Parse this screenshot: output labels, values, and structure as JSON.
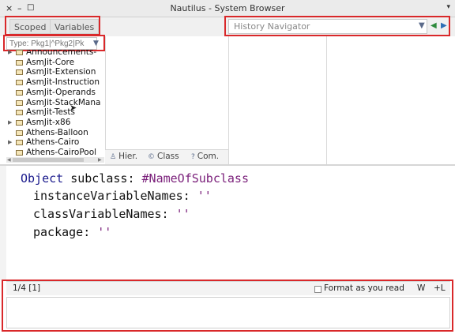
{
  "window": {
    "title": "Nautilus - System Browser",
    "controls": [
      "×",
      "–",
      "□"
    ]
  },
  "toolbar": {
    "tabs": [
      "Scoped",
      "Variables"
    ],
    "history_placeholder": "History Navigator"
  },
  "filter": {
    "placeholder": "Type: Pkg1|^Pkg2|Pk"
  },
  "packages": [
    {
      "label": "Announcements-",
      "expandable": true
    },
    {
      "label": "AsmJit-Core",
      "expandable": false
    },
    {
      "label": "AsmJit-Extension",
      "expandable": false
    },
    {
      "label": "AsmJit-Instruction",
      "expandable": false
    },
    {
      "label": "AsmJit-Operands",
      "expandable": false
    },
    {
      "label": "AsmJit-StackMana",
      "expandable": false
    },
    {
      "label": "AsmJit-Tests",
      "expandable": false
    },
    {
      "label": "AsmJit-x86",
      "expandable": true
    },
    {
      "label": "Athens-Balloon",
      "expandable": false
    },
    {
      "label": "Athens-Cairo",
      "expandable": true
    },
    {
      "label": "Athens-CairoPool",
      "expandable": false
    }
  ],
  "class_tabs": [
    {
      "label": "Hier.",
      "icon": "hierarchy-icon"
    },
    {
      "label": "Class",
      "icon": "class-icon"
    },
    {
      "label": "Com.",
      "icon": "comment-icon"
    }
  ],
  "code": {
    "line1_receiver": "Object",
    "line1_selector": " subclass: ",
    "line1_symbol": "#NameOfSubclass",
    "line2_key": "instanceVariableNames: ",
    "line2_val": "''",
    "line3_key": "classVariableNames: ",
    "line3_val": "''",
    "line4_key": "package: ",
    "line4_val": "''"
  },
  "status": {
    "position": "1/4 [1]",
    "format_label": "Format as you read",
    "format_checked": false,
    "wrap_label": "W",
    "line_label": "+L"
  },
  "colors": {
    "highlight": "#d9282a",
    "keyword": "#1a1a8c",
    "symbol": "#7a1f7a"
  }
}
